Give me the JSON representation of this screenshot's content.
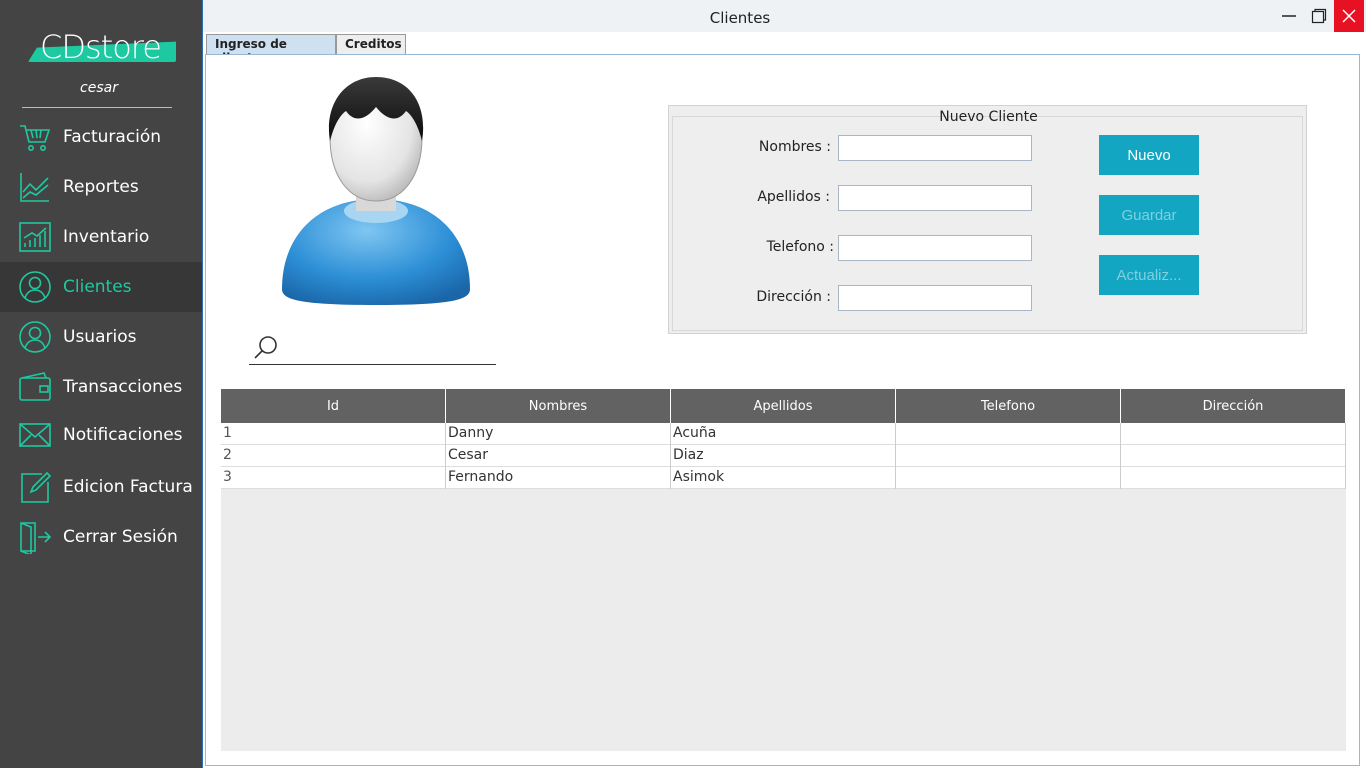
{
  "sidebar": {
    "logo": "CDstore",
    "username": "cesar",
    "items": [
      {
        "label": "Facturación",
        "icon": "cart-icon"
      },
      {
        "label": "Reportes",
        "icon": "chart-icon"
      },
      {
        "label": "Inventario",
        "icon": "inventory-chart-icon"
      },
      {
        "label": "Clientes",
        "icon": "user-circle-icon",
        "active": true
      },
      {
        "label": "Usuarios",
        "icon": "users-circle-icon"
      },
      {
        "label": "Transacciones",
        "icon": "wallet-icon"
      },
      {
        "label": "Notificaciones",
        "icon": "mail-icon"
      },
      {
        "label": "Edicion Factura",
        "icon": "edit-icon"
      },
      {
        "label": "Cerrar Sesión",
        "icon": "logout-icon"
      }
    ]
  },
  "window": {
    "title": "Clientes",
    "tabs": [
      "Ingreso de clientes",
      "Creditos"
    ]
  },
  "form": {
    "title": "Nuevo Cliente",
    "fields": {
      "nombres": {
        "label": "Nombres :",
        "value": ""
      },
      "apellidos": {
        "label": "Apellidos :",
        "value": ""
      },
      "telefono": {
        "label": "Telefono  :",
        "value": ""
      },
      "direccion": {
        "label": "Dirección :",
        "value": ""
      }
    },
    "buttons": {
      "nuevo": "Nuevo",
      "guardar": "Guardar",
      "actualizar": "Actualiz..."
    }
  },
  "search": {
    "value": ""
  },
  "table": {
    "columns": [
      "Id",
      "Nombres",
      "Apellidos",
      "Telefono",
      "Dirección"
    ],
    "rows": [
      [
        "1",
        "Danny",
        "Acuña",
        "",
        ""
      ],
      [
        "2",
        "Cesar",
        "Diaz",
        "",
        ""
      ],
      [
        "3",
        "Fernando",
        "Asimok",
        "",
        ""
      ]
    ]
  },
  "colors": {
    "accent": "#1dc9a1",
    "sidebar_bg": "#444444",
    "button": "#12a6c2",
    "table_header": "#626262"
  }
}
